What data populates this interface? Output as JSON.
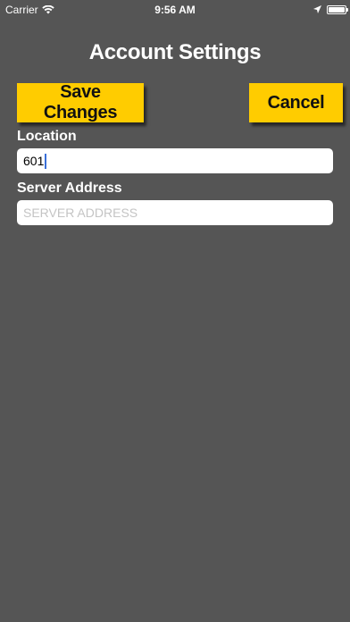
{
  "status_bar": {
    "carrier": "Carrier",
    "time": "9:56 AM",
    "icons": [
      "wifi-icon",
      "location-arrow-icon",
      "battery-icon"
    ]
  },
  "page": {
    "title": "Account Settings"
  },
  "buttons": {
    "save_label": "Save Changes",
    "cancel_label": "Cancel",
    "accent_color": "#ffcc00"
  },
  "fields": {
    "location": {
      "label": "Location",
      "value": "601"
    },
    "server_address": {
      "label": "Server Address",
      "value": "",
      "placeholder": "SERVER ADDRESS"
    }
  },
  "colors": {
    "background": "#555555",
    "text": "#ffffff"
  }
}
